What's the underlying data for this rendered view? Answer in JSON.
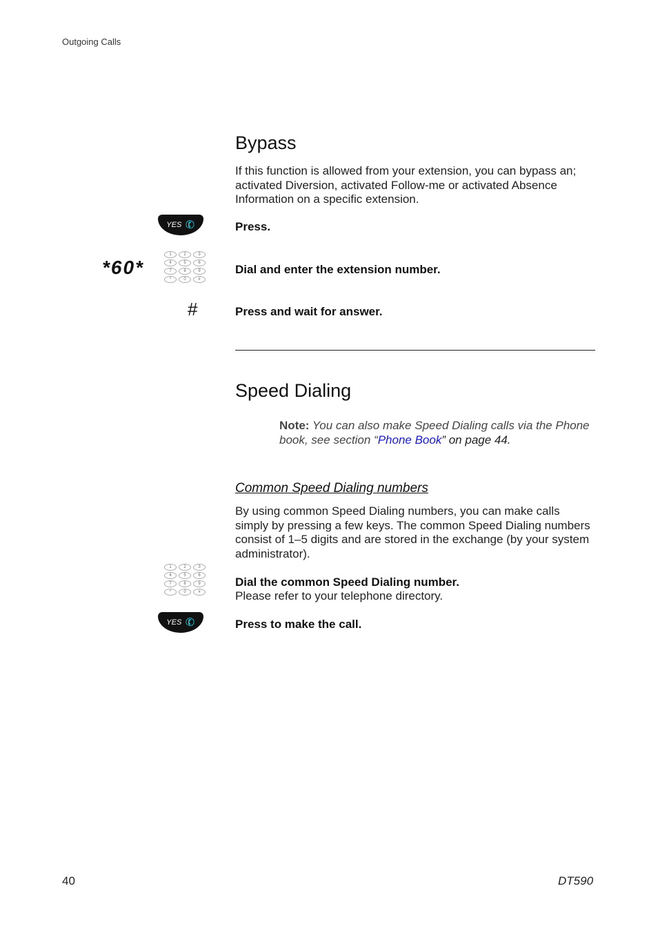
{
  "header": "Outgoing Calls",
  "bypass": {
    "title": "Bypass",
    "intro": "If this function is allowed from your extension, you can bypass an; activated Diversion, activated Follow-me or activated Absence Information on a specific extension.",
    "steps": [
      {
        "icon": "yes-key",
        "key_label": "YES",
        "text": "Press."
      },
      {
        "icon": "keypad",
        "code": "*60*",
        "text": "Dial and enter the extension number."
      },
      {
        "icon": "hash-key",
        "code": "#",
        "text": "Press and wait for answer."
      }
    ]
  },
  "speed": {
    "title": "Speed Dialing",
    "note_label": "Note:",
    "note_pre": " You can also make Speed Dialing calls via the Phone book, see section “",
    "note_link": "Phone Book",
    "note_post": "” on page 44.",
    "subtitle": "Common Speed Dialing numbers",
    "intro": "By using common Speed Dialing numbers, you can make calls simply by pressing a few keys. The common Speed Dialing numbers consist of 1–5 digits and are stored in the exchange (by your system administrator).",
    "steps": [
      {
        "icon": "keypad",
        "text": "Dial the common Speed Dialing number.",
        "subtext": "Please refer to your telephone directory."
      },
      {
        "icon": "yes-key",
        "key_label": "YES",
        "text": "Press to make the call."
      }
    ]
  },
  "keypad_keys": [
    "1",
    "2",
    "3",
    "4",
    "5",
    "6",
    "7",
    "8",
    "9",
    "*",
    "0",
    "#"
  ],
  "footer": {
    "page": "40",
    "model": "DT590"
  }
}
